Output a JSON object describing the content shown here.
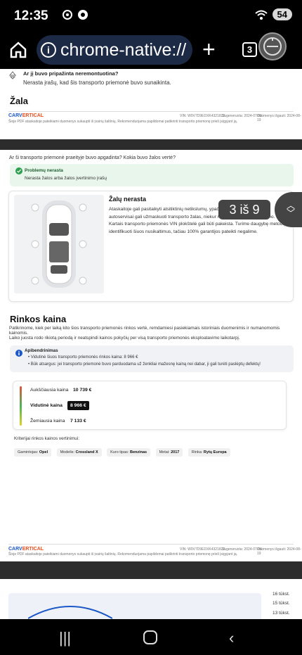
{
  "status": {
    "time": "12:35",
    "battery": "54"
  },
  "browser": {
    "url": "chrome-native://",
    "tab_count": "3"
  },
  "page": {
    "damage_question": "Ar jį buvo pripažinta neremontuotina?",
    "damage_answer": "Nerasta įrašų, kad šis transporto priemonė buvo sunaikinta.",
    "section_zala": "Žala",
    "footer1_vin": "VIN: W0V7D9EDXK4321823",
    "footer1_generated": "Sugeneruota: 2024-07-05",
    "footer1_updated": "Duomenys išgauti: 2024-08-19",
    "footer_disclaimer": "Šioje PDF ataskaitoje pateikiami duomenys sukaupti iš įvairių šaltinių. Rekomenduojama papildomai patikrinti transporto priemonę prieš įsigyjant ją.",
    "damage_prompt": "Ar ši transporto priemonė praeityje buvo apgadinta? Kokia buvo žalos vertė?",
    "alert_title": "Problemų nerasta",
    "alert_text": "Nerasta žalos arba žalos įvertinimo įrašų",
    "no_damage_title": "Žalų nerasta",
    "no_damage_text": "Ataskaitoje gali pasitaikyti atsitiktinių netikslumų, ypač priemones. Nelegalūs autoservisai gali užmaskuoti transporto žalas, niekur neįforminant jų egzistavimo. Kartais transporto priemonės VIN plokštelė gali būti pakeista. Turime daugybę metodų identifikuoti šiuos nusikaltimus, tačiau 100% garantijos pateikti negalime.",
    "market_title": "Rinkos kaina",
    "market_p1": "Patikrinome, kiek per laiką kito šios transporto priemonės rinkos vertė, remdamiesi pasiekiamais istoriniais duomenimis ir numanomomis kainomis.",
    "market_p2": "Laiko juosta rodo rikiotą periodą ir neatspindi kainos pokyčių per visą transporto priemonės eksploatavimo laikotarpį.",
    "summary_title": "Apibendrinimas",
    "summary_bullet1": "Vidutinė šiuos transporto priemonės rinkos kaina: 8 966 €",
    "summary_bullet2": "Būk atsargus: jei transporto priemonė buvo parduodama už ženkliai mažesnę kainą nei dabar, ji gali turėti paslėptų defektų!",
    "price_high_label": "Aukščiausia kaina",
    "price_high": "10 739 €",
    "price_avg_label": "Vidutinė kaina",
    "price_avg": "8 966 €",
    "price_low_label": "Žemiausia kaina",
    "price_low": "7 133 €",
    "criteria_title": "Kriterijai rinkos kainos vertinimui:",
    "chips": [
      {
        "k": "Gamintojas:",
        "v": "Opel"
      },
      {
        "k": "Modelis:",
        "v": "Crossland X"
      },
      {
        "k": "Kuro tipas:",
        "v": "Benzinas"
      },
      {
        "k": "Metai:",
        "v": "2017"
      },
      {
        "k": "Rinka:",
        "v": "Rytų Europa"
      }
    ],
    "logo_left": "CARV",
    "logo_mid": "ERTICAL",
    "find_counter": "3 iš 9",
    "chart_ticks": [
      "16 tūkst.",
      "15 tūkst.",
      "13 tūkst."
    ]
  },
  "colors": {
    "accent": "#1b57c6",
    "ok": "#2e9e4f",
    "high": "#e6533c",
    "avg": "#4cb45a",
    "low": "#e3cf2c"
  }
}
